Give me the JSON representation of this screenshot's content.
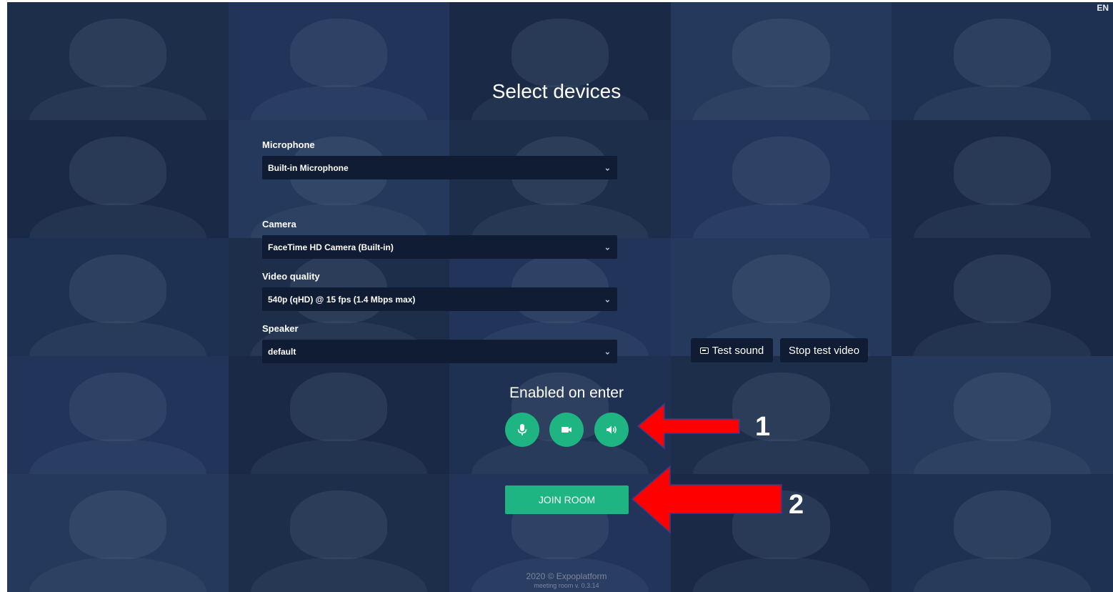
{
  "language": "EN",
  "title": "Select devices",
  "fields": [
    {
      "label": "Microphone",
      "value": "Built-in Microphone"
    },
    {
      "label": "Camera",
      "value": "FaceTime HD Camera (Built-in)"
    },
    {
      "label": "Video quality",
      "value": "540p (qHD) @ 15 fps (1.4 Mbps max)"
    },
    {
      "label": "Speaker",
      "value": "default"
    }
  ],
  "buttons": {
    "test_sound": "Test sound",
    "stop_test_video": "Stop test video",
    "join_room": "JOIN ROOM"
  },
  "enabled_on_enter": {
    "label": "Enabled on enter",
    "toggles": [
      "microphone-icon",
      "video-camera-icon",
      "speaker-icon"
    ]
  },
  "annotations": [
    "1",
    "2"
  ],
  "footer": {
    "copyright": "2020 © Expoplatform",
    "version": "meeting room v. 0.3.14"
  },
  "colors": {
    "accent": "#1fb583",
    "background": "#1b2b48",
    "select_bg": "#101c33",
    "arrow": "#ff0000"
  }
}
